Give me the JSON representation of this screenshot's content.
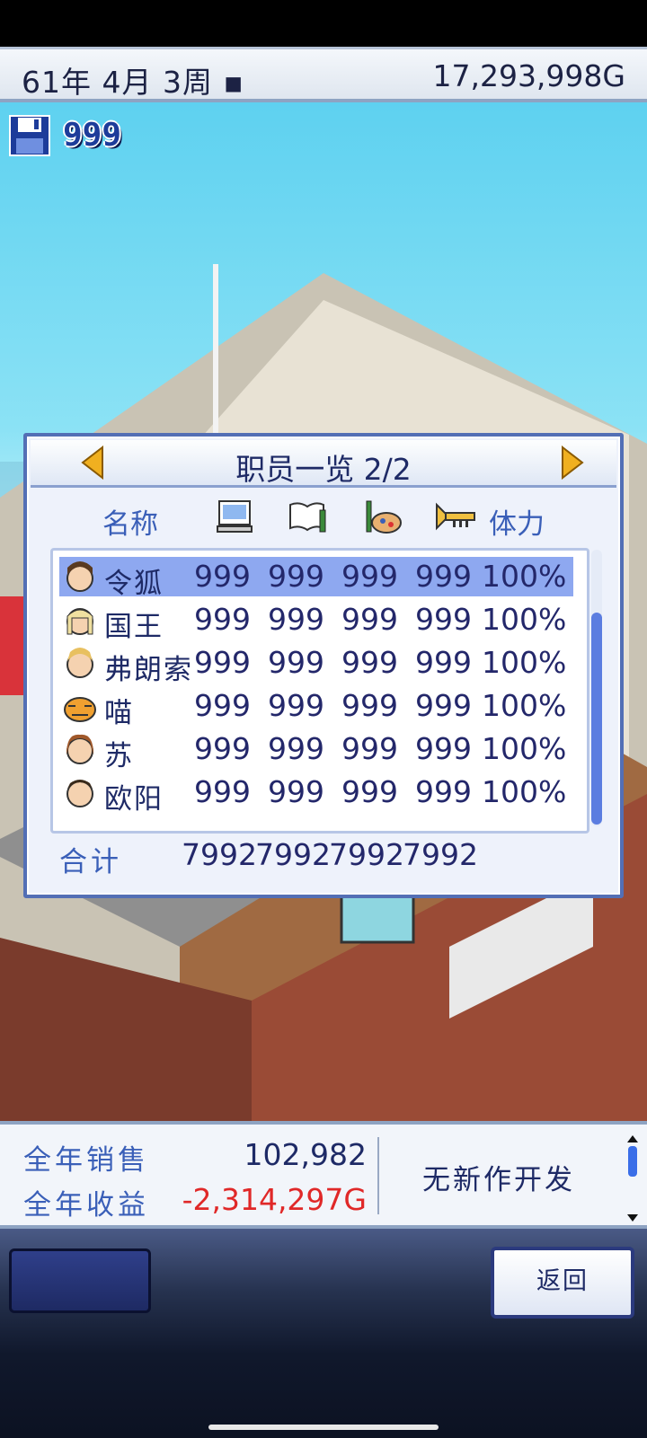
{
  "top_bar": {
    "date": "61年 4月 3周 ▪",
    "money": "17,293,998G"
  },
  "save": {
    "count": "999",
    "icon": "floppy-disk-icon"
  },
  "staff_panel": {
    "title": "职员一览 2/2",
    "columns": {
      "name": "名称",
      "stamina": "体力",
      "icons": [
        "computer-icon",
        "book-icon",
        "paint-icon",
        "trumpet-icon"
      ]
    },
    "rows": [
      {
        "name": "令狐",
        "v1": "999",
        "v2": "999",
        "v3": "999",
        "v4": "999",
        "stamina": "100%",
        "selected": true
      },
      {
        "name": "国王",
        "v1": "999",
        "v2": "999",
        "v3": "999",
        "v4": "999",
        "stamina": "100%"
      },
      {
        "name": "弗朗索",
        "v1": "999",
        "v2": "999",
        "v3": "999",
        "v4": "999",
        "stamina": "100%"
      },
      {
        "name": "喵",
        "v1": "999",
        "v2": "999",
        "v3": "999",
        "v4": "999",
        "stamina": "100%"
      },
      {
        "name": "苏",
        "v1": "999",
        "v2": "999",
        "v3": "999",
        "v4": "999",
        "stamina": "100%"
      },
      {
        "name": "欧阳",
        "v1": "999",
        "v2": "999",
        "v3": "999",
        "v4": "999",
        "stamina": "100%"
      }
    ],
    "total": {
      "label": "合计",
      "v1": "7992",
      "v2": "7992",
      "v3": "7992",
      "v4": "7992"
    }
  },
  "bottom_stats": {
    "annual_sales_label": "全年销售",
    "annual_sales_value": "102,982",
    "annual_profit_label": "全年收益",
    "annual_profit_value": "-2,314,297G",
    "dev_status": "无新作开发"
  },
  "nav": {
    "back_label": "返回"
  },
  "colors": {
    "accent": "#3a5fb8",
    "negative": "#e02828",
    "panel_border": "#536fb5"
  }
}
